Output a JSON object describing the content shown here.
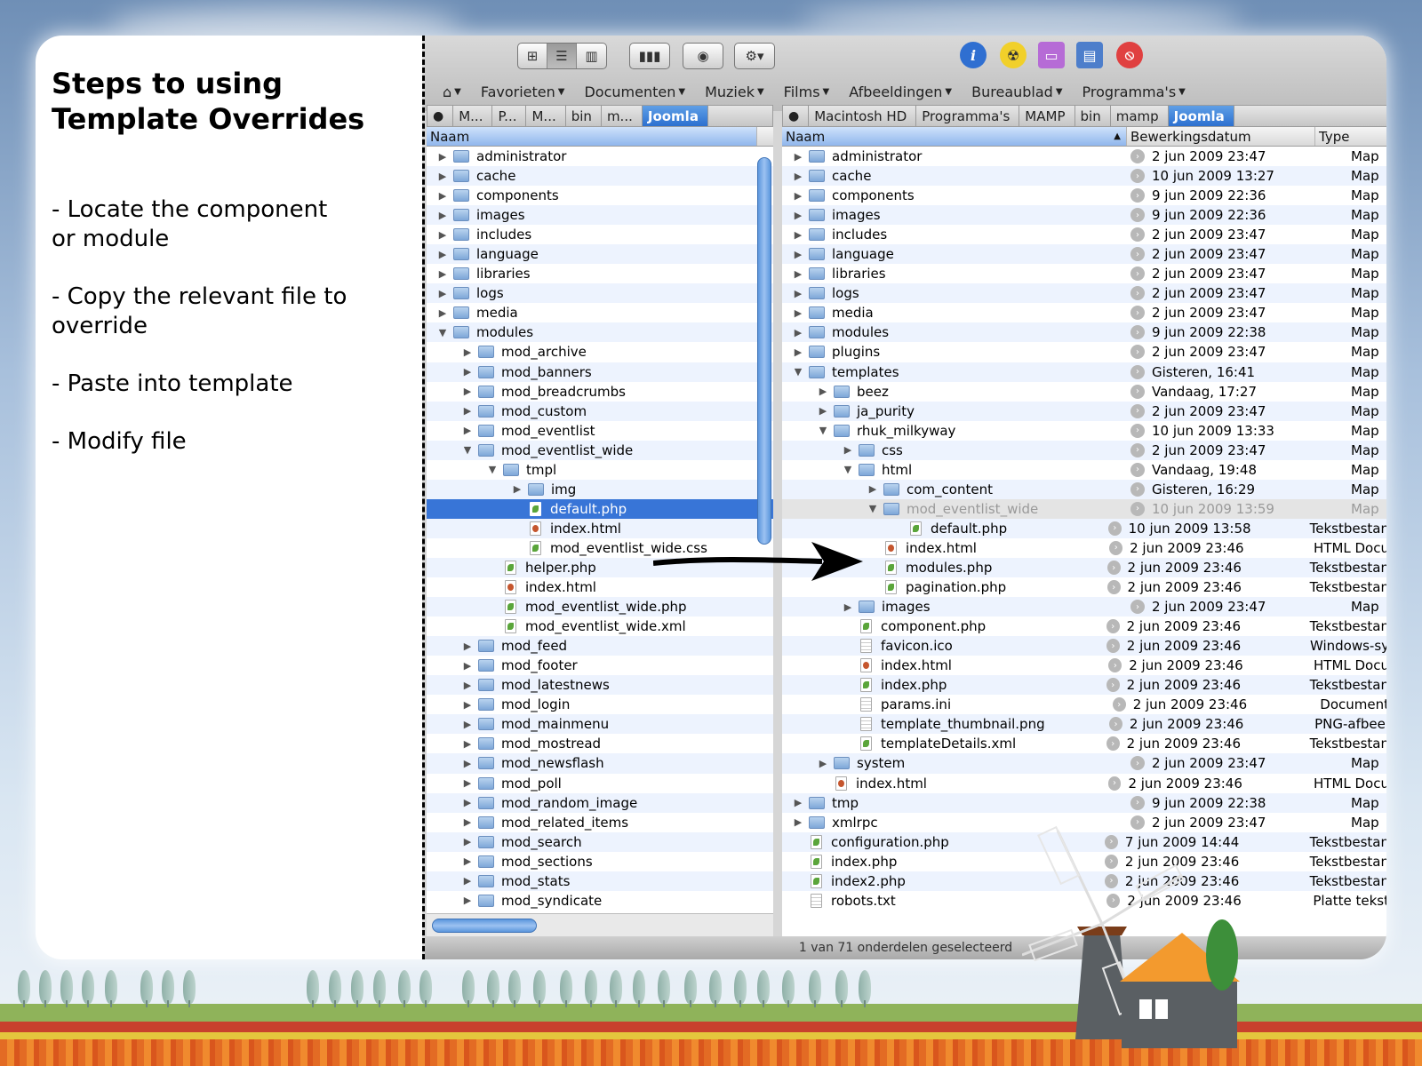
{
  "slide": {
    "title": "Steps to using\nTemplate Overrides",
    "bullets": [
      "- Locate the component\nor module",
      "- Copy the relevant file to\noverride",
      "- Paste into template",
      "- Modify file"
    ]
  },
  "toolbar": {
    "view_buttons": [
      "icon-view-icon",
      "list-view-icon",
      "column-view-icon"
    ],
    "apps": [
      "info-icon",
      "radiation-icon",
      "drive-icon",
      "window-icon",
      "stop-icon"
    ]
  },
  "places": [
    "Favorieten",
    "Documenten",
    "Muziek",
    "Films",
    "Afbeeldingen",
    "Bureaublad",
    "Programma's"
  ],
  "left_path": [
    "M...",
    "P...",
    "M...",
    "bin",
    "m...",
    "Joomla"
  ],
  "right_path": [
    "Macintosh HD",
    "Programma's",
    "MAMP",
    "bin",
    "mamp",
    "Joomla"
  ],
  "left_header": "Naam",
  "right_headers": {
    "name": "Naam",
    "date": "Bewerkingsdatum",
    "type": "Type"
  },
  "left_rows": [
    {
      "name": "administrator",
      "level": 0,
      "kind": "folder",
      "tri": "closed"
    },
    {
      "name": "cache",
      "level": 0,
      "kind": "folder",
      "tri": "closed"
    },
    {
      "name": "components",
      "level": 0,
      "kind": "folder",
      "tri": "closed"
    },
    {
      "name": "images",
      "level": 0,
      "kind": "folder",
      "tri": "closed"
    },
    {
      "name": "includes",
      "level": 0,
      "kind": "folder",
      "tri": "closed"
    },
    {
      "name": "language",
      "level": 0,
      "kind": "folder",
      "tri": "closed"
    },
    {
      "name": "libraries",
      "level": 0,
      "kind": "folder",
      "tri": "closed"
    },
    {
      "name": "logs",
      "level": 0,
      "kind": "folder",
      "tri": "closed"
    },
    {
      "name": "media",
      "level": 0,
      "kind": "folder",
      "tri": "closed"
    },
    {
      "name": "modules",
      "level": 0,
      "kind": "folder",
      "tri": "open"
    },
    {
      "name": "mod_archive",
      "level": 1,
      "kind": "folder",
      "tri": "closed"
    },
    {
      "name": "mod_banners",
      "level": 1,
      "kind": "folder",
      "tri": "closed"
    },
    {
      "name": "mod_breadcrumbs",
      "level": 1,
      "kind": "folder",
      "tri": "closed"
    },
    {
      "name": "mod_custom",
      "level": 1,
      "kind": "folder",
      "tri": "closed"
    },
    {
      "name": "mod_eventlist",
      "level": 1,
      "kind": "folder",
      "tri": "closed"
    },
    {
      "name": "mod_eventlist_wide",
      "level": 1,
      "kind": "folder",
      "tri": "open"
    },
    {
      "name": "tmpl",
      "level": 2,
      "kind": "folder",
      "tri": "open"
    },
    {
      "name": "img",
      "level": 3,
      "kind": "folder",
      "tri": "closed"
    },
    {
      "name": "default.php",
      "level": 3,
      "kind": "php",
      "tri": "none",
      "selected": true
    },
    {
      "name": "index.html",
      "level": 3,
      "kind": "html",
      "tri": "none"
    },
    {
      "name": "mod_eventlist_wide.css",
      "level": 3,
      "kind": "php",
      "tri": "none"
    },
    {
      "name": "helper.php",
      "level": 2,
      "kind": "php",
      "tri": "none"
    },
    {
      "name": "index.html",
      "level": 2,
      "kind": "html",
      "tri": "none"
    },
    {
      "name": "mod_eventlist_wide.php",
      "level": 2,
      "kind": "php",
      "tri": "none"
    },
    {
      "name": "mod_eventlist_wide.xml",
      "level": 2,
      "kind": "php",
      "tri": "none"
    },
    {
      "name": "mod_feed",
      "level": 1,
      "kind": "folder",
      "tri": "closed"
    },
    {
      "name": "mod_footer",
      "level": 1,
      "kind": "folder",
      "tri": "closed"
    },
    {
      "name": "mod_latestnews",
      "level": 1,
      "kind": "folder",
      "tri": "closed"
    },
    {
      "name": "mod_login",
      "level": 1,
      "kind": "folder",
      "tri": "closed"
    },
    {
      "name": "mod_mainmenu",
      "level": 1,
      "kind": "folder",
      "tri": "closed"
    },
    {
      "name": "mod_mostread",
      "level": 1,
      "kind": "folder",
      "tri": "closed"
    },
    {
      "name": "mod_newsflash",
      "level": 1,
      "kind": "folder",
      "tri": "closed"
    },
    {
      "name": "mod_poll",
      "level": 1,
      "kind": "folder",
      "tri": "closed"
    },
    {
      "name": "mod_random_image",
      "level": 1,
      "kind": "folder",
      "tri": "closed"
    },
    {
      "name": "mod_related_items",
      "level": 1,
      "kind": "folder",
      "tri": "closed"
    },
    {
      "name": "mod_search",
      "level": 1,
      "kind": "folder",
      "tri": "closed"
    },
    {
      "name": "mod_sections",
      "level": 1,
      "kind": "folder",
      "tri": "closed"
    },
    {
      "name": "mod_stats",
      "level": 1,
      "kind": "folder",
      "tri": "closed"
    },
    {
      "name": "mod_syndicate",
      "level": 1,
      "kind": "folder",
      "tri": "closed"
    }
  ],
  "right_rows": [
    {
      "name": "administrator",
      "level": 0,
      "kind": "folder",
      "tri": "closed",
      "date": "2 jun 2009 23:47",
      "type": "Map"
    },
    {
      "name": "cache",
      "level": 0,
      "kind": "folder",
      "tri": "closed",
      "date": "10 jun 2009 13:27",
      "type": "Map"
    },
    {
      "name": "components",
      "level": 0,
      "kind": "folder",
      "tri": "closed",
      "date": "9 jun 2009 22:36",
      "type": "Map"
    },
    {
      "name": "images",
      "level": 0,
      "kind": "folder",
      "tri": "closed",
      "date": "9 jun 2009 22:36",
      "type": "Map"
    },
    {
      "name": "includes",
      "level": 0,
      "kind": "folder",
      "tri": "closed",
      "date": "2 jun 2009 23:47",
      "type": "Map"
    },
    {
      "name": "language",
      "level": 0,
      "kind": "folder",
      "tri": "closed",
      "date": "2 jun 2009 23:47",
      "type": "Map"
    },
    {
      "name": "libraries",
      "level": 0,
      "kind": "folder",
      "tri": "closed",
      "date": "2 jun 2009 23:47",
      "type": "Map"
    },
    {
      "name": "logs",
      "level": 0,
      "kind": "folder",
      "tri": "closed",
      "date": "2 jun 2009 23:47",
      "type": "Map"
    },
    {
      "name": "media",
      "level": 0,
      "kind": "folder",
      "tri": "closed",
      "date": "2 jun 2009 23:47",
      "type": "Map"
    },
    {
      "name": "modules",
      "level": 0,
      "kind": "folder",
      "tri": "closed",
      "date": "9 jun 2009 22:38",
      "type": "Map"
    },
    {
      "name": "plugins",
      "level": 0,
      "kind": "folder",
      "tri": "closed",
      "date": "2 jun 2009 23:47",
      "type": "Map"
    },
    {
      "name": "templates",
      "level": 0,
      "kind": "folder",
      "tri": "open",
      "date": "Gisteren, 16:41",
      "type": "Map"
    },
    {
      "name": "beez",
      "level": 1,
      "kind": "folder",
      "tri": "closed",
      "date": "Vandaag, 17:27",
      "type": "Map"
    },
    {
      "name": "ja_purity",
      "level": 1,
      "kind": "folder",
      "tri": "closed",
      "date": "2 jun 2009 23:47",
      "type": "Map"
    },
    {
      "name": "rhuk_milkyway",
      "level": 1,
      "kind": "folder",
      "tri": "open",
      "date": "10 jun 2009 13:33",
      "type": "Map"
    },
    {
      "name": "css",
      "level": 2,
      "kind": "folder",
      "tri": "closed",
      "date": "2 jun 2009 23:47",
      "type": "Map"
    },
    {
      "name": "html",
      "level": 2,
      "kind": "folder",
      "tri": "open",
      "date": "Vandaag, 19:48",
      "type": "Map"
    },
    {
      "name": "com_content",
      "level": 3,
      "kind": "folder",
      "tri": "closed",
      "date": "Gisteren, 16:29",
      "type": "Map"
    },
    {
      "name": "mod_eventlist_wide",
      "level": 3,
      "kind": "folder",
      "tri": "open",
      "date": "10 jun 2009 13:59",
      "type": "Map",
      "dimmed": true
    },
    {
      "name": "default.php",
      "level": 4,
      "kind": "php",
      "tri": "none",
      "date": "10 jun 2009 13:58",
      "type": "Tekstbestan"
    },
    {
      "name": "index.html",
      "level": 3,
      "kind": "html",
      "tri": "none",
      "date": "2 jun 2009 23:46",
      "type": "HTML Docu"
    },
    {
      "name": "modules.php",
      "level": 3,
      "kind": "php",
      "tri": "none",
      "date": "2 jun 2009 23:46",
      "type": "Tekstbestan"
    },
    {
      "name": "pagination.php",
      "level": 3,
      "kind": "php",
      "tri": "none",
      "date": "2 jun 2009 23:46",
      "type": "Tekstbestan"
    },
    {
      "name": "images",
      "level": 2,
      "kind": "folder",
      "tri": "closed",
      "date": "2 jun 2009 23:47",
      "type": "Map"
    },
    {
      "name": "component.php",
      "level": 2,
      "kind": "php",
      "tri": "none",
      "date": "2 jun 2009 23:46",
      "type": "Tekstbestan"
    },
    {
      "name": "favicon.ico",
      "level": 2,
      "kind": "plain",
      "tri": "none",
      "date": "2 jun 2009 23:46",
      "type": "Windows-sy"
    },
    {
      "name": "index.html",
      "level": 2,
      "kind": "html",
      "tri": "none",
      "date": "2 jun 2009 23:46",
      "type": "HTML Docu"
    },
    {
      "name": "index.php",
      "level": 2,
      "kind": "php",
      "tri": "none",
      "date": "2 jun 2009 23:46",
      "type": "Tekstbestan"
    },
    {
      "name": "params.ini",
      "level": 2,
      "kind": "plain",
      "tri": "none",
      "date": "2 jun 2009 23:46",
      "type": "Document"
    },
    {
      "name": "template_thumbnail.png",
      "level": 2,
      "kind": "plain",
      "tri": "none",
      "date": "2 jun 2009 23:46",
      "type": "PNG-afbeel"
    },
    {
      "name": "templateDetails.xml",
      "level": 2,
      "kind": "php",
      "tri": "none",
      "date": "2 jun 2009 23:46",
      "type": "Tekstbestan"
    },
    {
      "name": "system",
      "level": 1,
      "kind": "folder",
      "tri": "closed",
      "date": "2 jun 2009 23:47",
      "type": "Map"
    },
    {
      "name": "index.html",
      "level": 1,
      "kind": "html",
      "tri": "none",
      "date": "2 jun 2009 23:46",
      "type": "HTML Docu"
    },
    {
      "name": "tmp",
      "level": 0,
      "kind": "folder",
      "tri": "closed",
      "date": "9 jun 2009 22:38",
      "type": "Map"
    },
    {
      "name": "xmlrpc",
      "level": 0,
      "kind": "folder",
      "tri": "closed",
      "date": "2 jun 2009 23:47",
      "type": "Map"
    },
    {
      "name": "configuration.php",
      "level": 0,
      "kind": "php",
      "tri": "none",
      "date": "7 jun 2009 14:44",
      "type": "Tekstbestan"
    },
    {
      "name": "index.php",
      "level": 0,
      "kind": "php",
      "tri": "none",
      "date": "2 jun 2009 23:46",
      "type": "Tekstbestan"
    },
    {
      "name": "index2.php",
      "level": 0,
      "kind": "php",
      "tri": "none",
      "date": "2 jun 2009 23:46",
      "type": "Tekstbestan"
    },
    {
      "name": "robots.txt",
      "level": 0,
      "kind": "plain",
      "tri": "none",
      "date": "2 jun 2009 23:46",
      "type": "Platte tekst"
    }
  ],
  "status_text": "1 van 71 onderdelen geselecteerd",
  "colors": {
    "selection": "#3875d7",
    "alt_row": "#edf3fe",
    "path_current": "#2c70d0"
  }
}
